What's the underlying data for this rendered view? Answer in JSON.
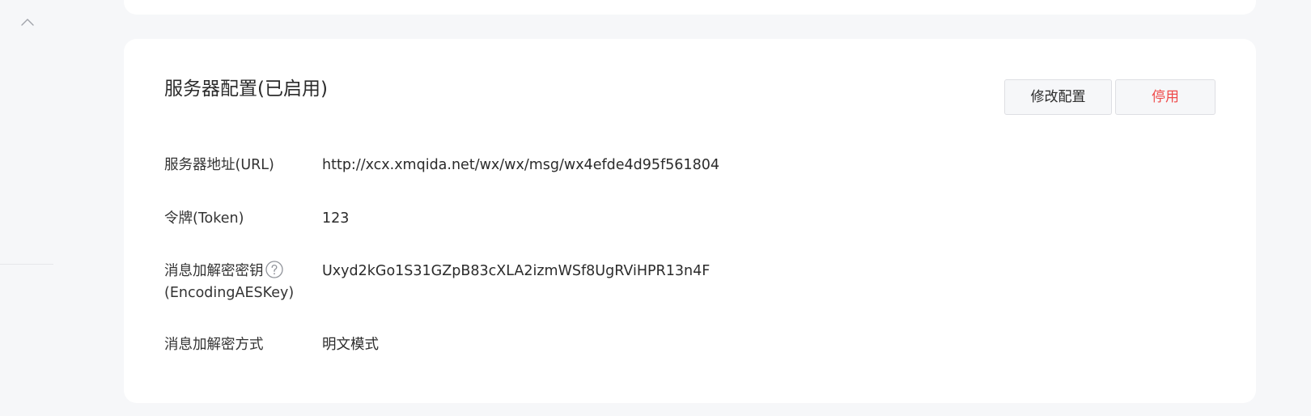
{
  "sidebar": {
    "collapse_icon": "chevron-up-icon"
  },
  "server_config": {
    "title": "服务器配置(已启用)",
    "buttons": {
      "edit_label": "修改配置",
      "disable_label": "停用"
    },
    "rows": [
      {
        "label": "服务器地址(URL)",
        "value": "http://xcx.xmqida.net/wx/wx/msg/wx4efde4d95f561804"
      },
      {
        "label": "令牌(Token)",
        "value": "123"
      },
      {
        "label_line1": "消息加解密密钥",
        "label_line2": "(EncodingAESKey)",
        "help_icon": "question-circle-icon",
        "value": "Uxyd2kGo1S31GZpB83cXLA2izmWSf8UgRViHPR13n4F"
      },
      {
        "label": "消息加解密方式",
        "value": "明文模式"
      }
    ]
  },
  "colors": {
    "page_background": "#f6f7f9",
    "card_background": "#ffffff",
    "text": "#2b2b2b",
    "danger": "#ef4a4a",
    "button_border": "#dedfe3",
    "icon_gray": "#a0a3aa"
  }
}
